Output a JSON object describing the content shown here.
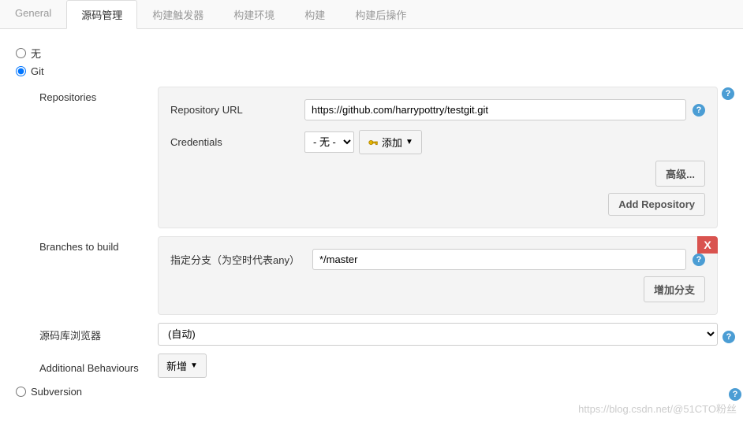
{
  "tabs": {
    "general": "General",
    "scm": "源码管理",
    "triggers": "构建触发器",
    "env": "构建环境",
    "build": "构建",
    "post": "构建后操作"
  },
  "scm": {
    "none": "无",
    "git": "Git",
    "subversion": "Subversion"
  },
  "git": {
    "repositories_label": "Repositories",
    "repo_url_label": "Repository URL",
    "repo_url_value": "https://github.com/harrypottry/testgit.git",
    "credentials_label": "Credentials",
    "credentials_value": "- 无 -",
    "add_btn": "添加",
    "advanced_btn": "高级...",
    "add_repo_btn": "Add Repository",
    "branches_label": "Branches to build",
    "branch_spec_label": "指定分支（为空时代表any）",
    "branch_spec_value": "*/master",
    "add_branch_btn": "增加分支",
    "browser_label": "源码库浏览器",
    "browser_value": "(自动)",
    "behaviours_label": "Additional Behaviours",
    "behaviours_btn": "新增"
  },
  "watermark": "https://blog.csdn.net/@51CTO粉丝"
}
